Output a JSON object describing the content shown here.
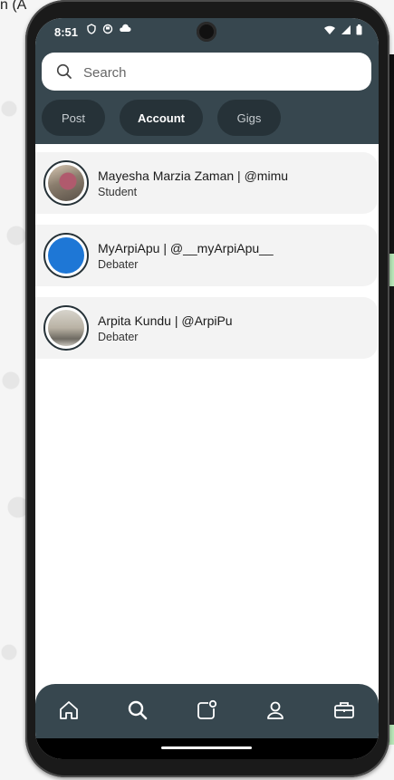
{
  "status_bar": {
    "time": "8:51"
  },
  "search": {
    "placeholder": "Search"
  },
  "tabs": [
    {
      "label": "Post",
      "active": false
    },
    {
      "label": "Account",
      "active": true
    },
    {
      "label": "Gigs",
      "active": false
    }
  ],
  "results": [
    {
      "name": "Mayesha Marzia Zaman | @mimu",
      "role": "Student",
      "avatar": "photo"
    },
    {
      "name": "MyArpiApu | @__myArpiApu__",
      "role": "Debater",
      "avatar": "blue-circle"
    },
    {
      "name": "Arpita Kundu | @ArpiPu",
      "role": "Debater",
      "avatar": "photo"
    }
  ],
  "nav": [
    "home-icon",
    "search-icon",
    "create-post-icon",
    "profile-icon",
    "gigs-briefcase-icon"
  ],
  "colors": {
    "header": "#37474f",
    "chip": "#263238",
    "accent_avatar": "#1e77d6"
  }
}
